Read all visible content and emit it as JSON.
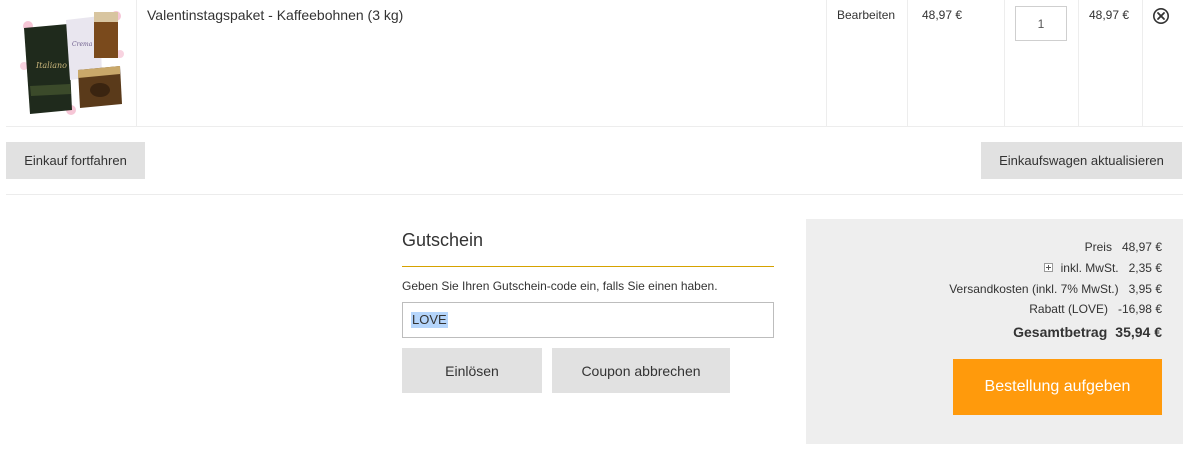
{
  "cart": {
    "item": {
      "name": "Valentinstagspaket - Kaffeebohnen (3 kg)",
      "edit_label": "Bearbeiten",
      "price": "48,97 €",
      "quantity": "1",
      "subtotal": "48,97 €",
      "image_icon": "coffee-gift-set-image"
    },
    "remove_icon": "close-circle-icon"
  },
  "actions": {
    "continue_label": "Einkauf fortfahren",
    "update_label": "Einkaufswagen aktualisieren"
  },
  "coupon": {
    "title": "Gutschein",
    "hint": "Geben Sie Ihren Gutschein-code ein, falls Sie einen haben.",
    "value": "LOVE",
    "redeem_label": "Einlösen",
    "cancel_label": "Coupon abbrechen"
  },
  "totals": {
    "price_label": "Preis",
    "price_value": "48,97 €",
    "tax_label": "inkl. MwSt.",
    "tax_value": "2,35 €",
    "shipping_label": "Versandkosten (inkl. 7% MwSt.)",
    "shipping_value": "3,95 €",
    "discount_label": "Rabatt (LOVE)",
    "discount_value": "-16,98 €",
    "grand_label": "Gesamtbetrag",
    "grand_value": "35,94 €",
    "checkout_label": "Bestellung aufgeben"
  },
  "colors": {
    "accent": "#ff9a0c",
    "coupon_rule": "#d6a200",
    "button_grey": "#e1e1e1",
    "totals_bg": "#eeeeee"
  }
}
